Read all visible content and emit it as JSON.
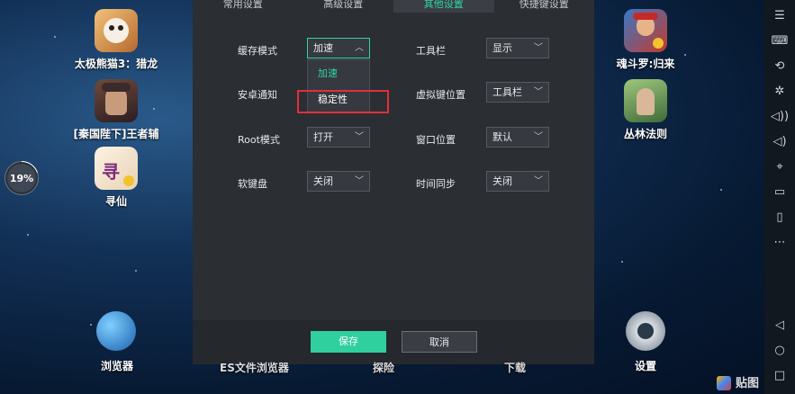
{
  "desktop": {
    "left_apps": [
      {
        "label": "太极熊猫3：猎龙"
      },
      {
        "label": "[秦国陛下]王者辅"
      },
      {
        "label": "寻仙"
      }
    ],
    "right_apps": [
      {
        "label": "魂斗罗:归来"
      },
      {
        "label": "丛林法则"
      }
    ],
    "bottom_apps": [
      {
        "label": "浏览器"
      },
      {
        "label": "ES文件浏览器"
      },
      {
        "label": "探险"
      },
      {
        "label": "下载"
      },
      {
        "label": "设置"
      }
    ],
    "progress_ring": {
      "value": "19%"
    },
    "watermark": "贴图"
  },
  "dialog": {
    "tabs": [
      {
        "label": "常用设置"
      },
      {
        "label": "高级设置"
      },
      {
        "label": "其他设置"
      },
      {
        "label": "快捷键设置"
      }
    ],
    "active_tab": "其他设置",
    "settings": {
      "cache_mode": {
        "label": "缓存模式",
        "value": "加速",
        "options": [
          "加速",
          "稳定性"
        ]
      },
      "toolbar": {
        "label": "工具栏",
        "value": "显示"
      },
      "android_notify": {
        "label": "安卓通知"
      },
      "virtual_key_pos": {
        "label": "虚拟键位置",
        "value": "工具栏"
      },
      "root_mode": {
        "label": "Root模式",
        "value": "打开"
      },
      "window_pos": {
        "label": "窗口位置",
        "value": "默认"
      },
      "soft_keyboard": {
        "label": "软键盘",
        "value": "关闭"
      },
      "time_sync": {
        "label": "时间同步",
        "value": "关闭"
      }
    },
    "footer": {
      "save_label": "保存",
      "cancel_label": "取消"
    }
  },
  "colors": {
    "accent": "#2fd6a5",
    "dialog_bg": "#2b2e33",
    "highlight": "#e0303a"
  }
}
